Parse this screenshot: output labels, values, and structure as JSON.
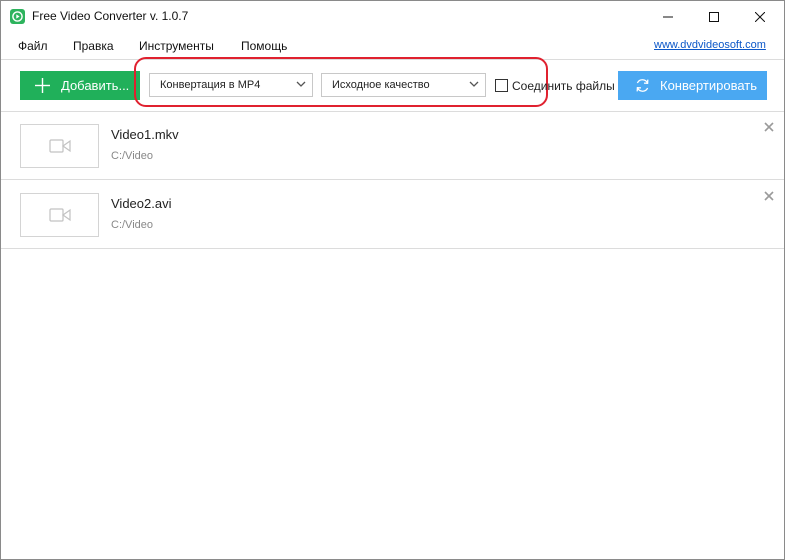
{
  "window": {
    "title": "Free Video Converter v. 1.0.7",
    "icon": "app-play-icon",
    "controls": [
      "minimize-icon",
      "maximize-icon",
      "close-icon"
    ]
  },
  "menu": {
    "file": "Файл",
    "edit": "Правка",
    "tools": "Инструменты",
    "help": "Помощь",
    "site_link": "www.dvdvideosoft.com"
  },
  "toolbar": {
    "add_label": "Добавить...",
    "format_value": "Конвертация в MP4",
    "quality_value": "Исходное качество",
    "join_label": "Соединить файлы",
    "join_checked": false,
    "convert_label": "Конвертировать"
  },
  "files": [
    {
      "name": "Video1.mkv",
      "path": "C:/Video"
    },
    {
      "name": "Video2.avi",
      "path": "C:/Video"
    }
  ],
  "colors": {
    "add_button": "#20b05a",
    "convert_button": "#4aa8f2",
    "highlight": "#e0212f",
    "link": "#0b57c8"
  }
}
